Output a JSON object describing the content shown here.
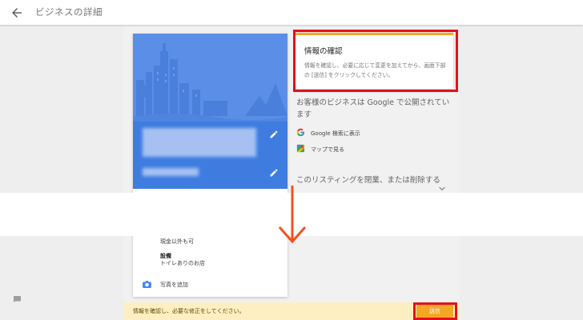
{
  "header": {
    "title": "ビジネスの詳細"
  },
  "confirm": {
    "title": "情報の確認",
    "body": "情報を確認し、必要に応じて変更を加えてから、画面下部の [送信] をクリックしてください。"
  },
  "public_notice": "お客様のビジネスは Google で公開されています",
  "links": [
    {
      "icon": "google-g-icon",
      "label": "Google 検索に表示"
    },
    {
      "icon": "maps-icon",
      "label": "マップで見る"
    }
  ],
  "close_listing": "このリスティングを閉業、または削除する",
  "card": {
    "payment_value": "現金以外も可",
    "facility_label": "設備",
    "facility_value": "トイレありのお店",
    "add_photo": "写真を追加"
  },
  "bottom": {
    "message": "情報を確認し、必要な修正をしてください。",
    "send_label": "送信"
  },
  "colors": {
    "accent": "#f5a623",
    "highlight": "#e5101a",
    "hero_blue": "#5b8ee6",
    "card_blue": "#3e7ce0",
    "notice_bg": "#fdefc2"
  }
}
